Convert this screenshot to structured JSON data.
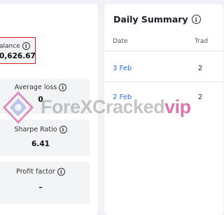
{
  "stats": {
    "balance": {
      "label": "alance",
      "value": "0,626.67"
    },
    "average_loss": {
      "label": "Average loss",
      "value": "0"
    },
    "sharpe_ratio": {
      "label": "Sharpe Ratio",
      "value": "6.41"
    },
    "profit_factor": {
      "label": "Profit factor",
      "value": "–"
    }
  },
  "daily_summary": {
    "title": "Daily Summary",
    "columns": [
      "Date",
      "Trad"
    ],
    "rows": [
      {
        "date": "3 Feb",
        "trades": "2"
      },
      {
        "date": "2 Feb",
        "trades": "2"
      }
    ]
  },
  "watermark": {
    "text": "ForeXCracked",
    "suffix": "vip"
  },
  "icons": {
    "info": "info-icon",
    "logo": "watermark-logo"
  },
  "colors": {
    "highlight_border": "#d41f2a",
    "link": "#2a6fd6"
  }
}
